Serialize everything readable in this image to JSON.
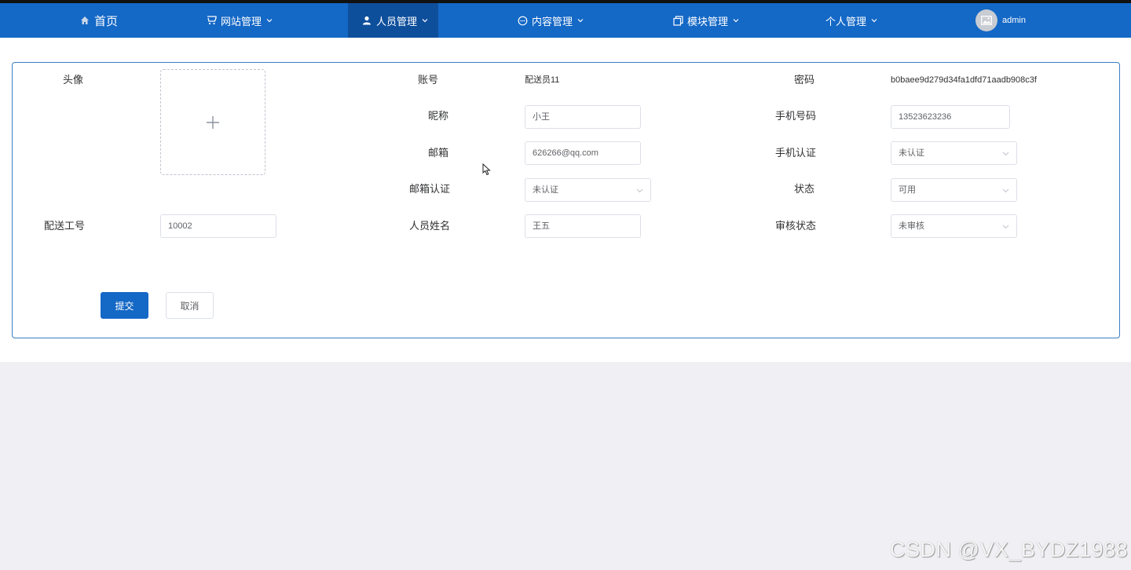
{
  "nav": {
    "home": "首页",
    "website": "网站管理",
    "personnel": "人员管理",
    "content": "内容管理",
    "module": "模块管理",
    "personal": "个人管理",
    "user": "admin"
  },
  "form": {
    "avatar_label": "头像",
    "account_label": "账号",
    "account_value": "配送员11",
    "password_label": "密码",
    "password_value": "b0baee9d279d34fa1dfd71aadb908c3f",
    "nickname_label": "昵称",
    "nickname_value": "小王",
    "phone_label": "手机号码",
    "phone_value": "13523623236",
    "email_label": "邮箱",
    "email_value": "626266@qq.com",
    "phone_verify_label": "手机认证",
    "phone_verify_value": "未认证",
    "email_verify_label": "邮箱认证",
    "email_verify_value": "未认证",
    "status_label": "状态",
    "status_value": "可用",
    "staff_no_label": "配送工号",
    "staff_no_value": "10002",
    "real_name_label": "人员姓名",
    "real_name_value": "王五",
    "audit_label": "审核状态",
    "audit_value": "未审核",
    "submit": "提交",
    "cancel": "取消"
  },
  "watermark": "CSDN @VX_BYDZ1988",
  "colors": {
    "primary": "#1468c6",
    "active_nav": "#0e4f9c",
    "card_border": "#3a7fc4"
  },
  "icons": [
    "home-icon",
    "shop-icon",
    "user-icon",
    "chat-icon",
    "copy-icon",
    "chevron-down-icon",
    "image-icon",
    "plus-icon"
  ]
}
